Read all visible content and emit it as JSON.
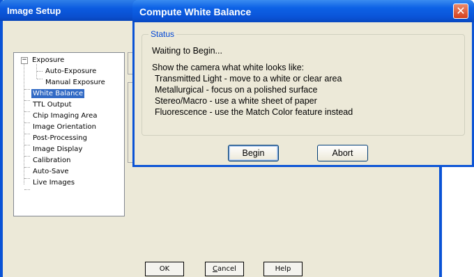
{
  "setup": {
    "title": "Image Setup",
    "tree": {
      "expander": "−",
      "items": [
        "Exposure",
        "Auto-Exposure",
        "Manual Exposure",
        "White Balance",
        "TTL Output",
        "Chip Imaging Area",
        "Image Orientation",
        "Post-Processing",
        "Image Display",
        "Calibration",
        "Auto-Save",
        "Live Images"
      ],
      "selected": "White Balance"
    },
    "buttons": {
      "ok": "OK",
      "cancel_first": "C",
      "cancel_rest": "ancel",
      "help": "Help"
    }
  },
  "dialog": {
    "title": "Compute White Balance",
    "close_glyph": "✕",
    "group_label": "Status",
    "status_text": "Waiting to Begin...",
    "instructions": [
      "Show the camera what white looks like:",
      "Transmitted Light - move to a white or clear area",
      "Metallurgical - focus on a polished surface",
      "Stereo/Macro - use a white sheet of paper",
      "Fluorescence - use the Match Color feature instead"
    ],
    "begin_label": "Begin",
    "abort_label": "Abort"
  },
  "colors": {
    "title_bar_blue": "#0a53d6",
    "selection_blue": "#316ac5",
    "group_label_blue": "#0046d5",
    "close_red": "#d6401c",
    "window_face": "#ece9d8"
  }
}
